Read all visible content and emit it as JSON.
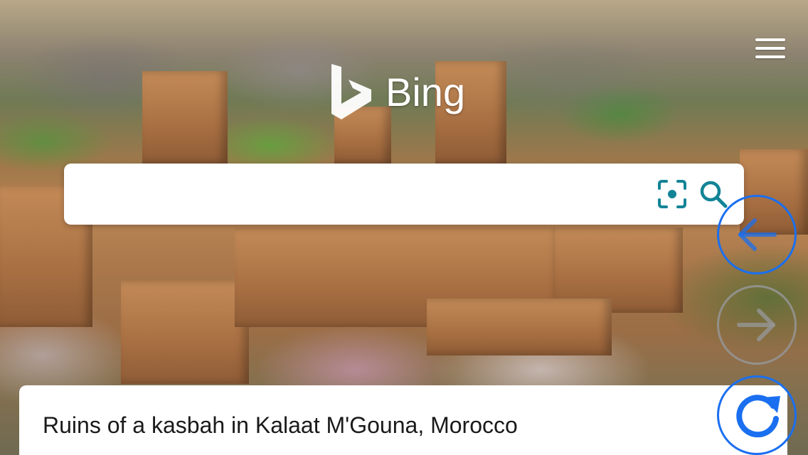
{
  "brand": {
    "name": "Bing",
    "accent_color": "#138496",
    "logo_icon": "bing-b-icon"
  },
  "header": {
    "menu_icon": "hamburger-menu-icon"
  },
  "search": {
    "value": "",
    "placeholder": "",
    "visual_search_icon": "camera-visual-search-icon",
    "submit_icon": "search-icon"
  },
  "image_of_day": {
    "caption": "Ruins of a kasbah in Kalaat M'Gouna, Morocco"
  },
  "browser_nav": {
    "back_icon": "arrow-left-icon",
    "forward_icon": "arrow-right-icon",
    "reload_icon": "reload-icon",
    "active_color": "#1a6ff0",
    "disabled_color": "#969696"
  }
}
